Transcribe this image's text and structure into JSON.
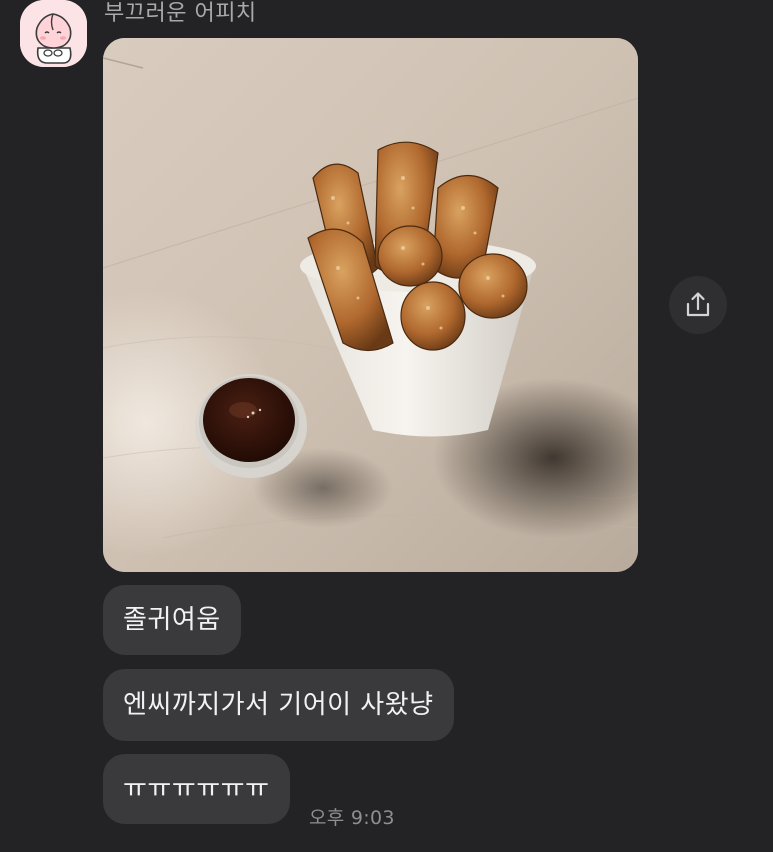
{
  "sender": {
    "name": "부끄러운 어피치",
    "avatar_icon": "apeach-peach-character-icon"
  },
  "photo": {
    "subject": "churros-in-cup-with-chocolate-dip"
  },
  "share_icon": "share-upload-icon",
  "messages": [
    {
      "text": "졸귀여움"
    },
    {
      "text": "엔씨까지가서 기어이 사왔냥"
    },
    {
      "text": "ㅠㅠㅠㅠㅠㅠ"
    }
  ],
  "timestamp": "오후 9:03",
  "colors": {
    "background": "#232325",
    "bubble": "#3a3a3c",
    "avatar_bg": "#fbe3e6"
  }
}
